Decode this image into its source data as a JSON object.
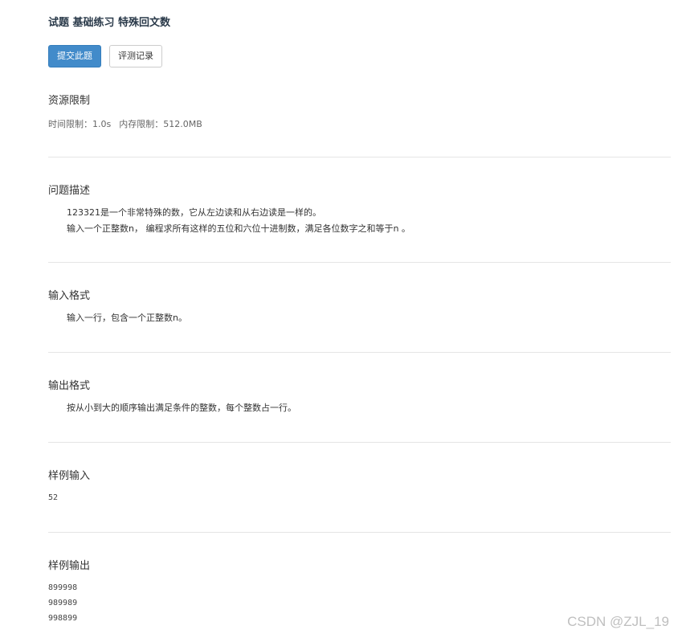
{
  "header": {
    "title": "试题 基础练习 特殊回文数"
  },
  "toolbar": {
    "submit_label": "提交此题",
    "records_label": "评测记录"
  },
  "resource": {
    "heading": "资源限制",
    "time_limit": "时间限制：1.0s",
    "memory_limit": "内存限制：512.0MB"
  },
  "description": {
    "heading": "问题描述",
    "line1": "123321是一个非常特殊的数，它从左边读和从右边读是一样的。",
    "line2": "输入一个正整数n， 编程求所有这样的五位和六位十进制数，满足各位数字之和等于n 。"
  },
  "input_format": {
    "heading": "输入格式",
    "text": "输入一行，包含一个正整数n。"
  },
  "output_format": {
    "heading": "输出格式",
    "text": "按从小到大的顺序输出满足条件的整数，每个整数占一行。"
  },
  "sample_input": {
    "heading": "样例输入",
    "lines": [
      "52"
    ]
  },
  "sample_output": {
    "heading": "样例输出",
    "lines": [
      "899998",
      "989989",
      "998899"
    ]
  },
  "watermark": "CSDN @ZJL_19",
  "colors": {
    "primary": "#428bca",
    "divider": "#e5e5e5"
  }
}
